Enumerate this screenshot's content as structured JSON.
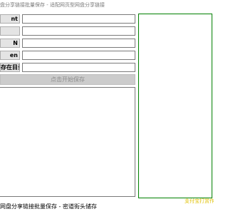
{
  "window": {
    "title": "盘分享链接批量保存 - 适配网页型网盘分享链接"
  },
  "form": {
    "rows": [
      {
        "label": "nt",
        "value": ""
      },
      {
        "label": "",
        "value": ""
      },
      {
        "label": "N",
        "value": ""
      },
      {
        "label": "en",
        "value": ""
      },
      {
        "label": "存在目录",
        "value": ""
      }
    ]
  },
  "actions": {
    "start_label": "点击开始保存"
  },
  "log": {
    "text": ""
  },
  "right_panel": {
    "caption": "支付宝打赏作者"
  },
  "status": {
    "text": "网盘分享链接批量保存 - 密道街头储存"
  },
  "colors": {
    "panel_border": "#008000",
    "caption": "#e0c000",
    "button_disabled_bg": "#cccccc"
  }
}
